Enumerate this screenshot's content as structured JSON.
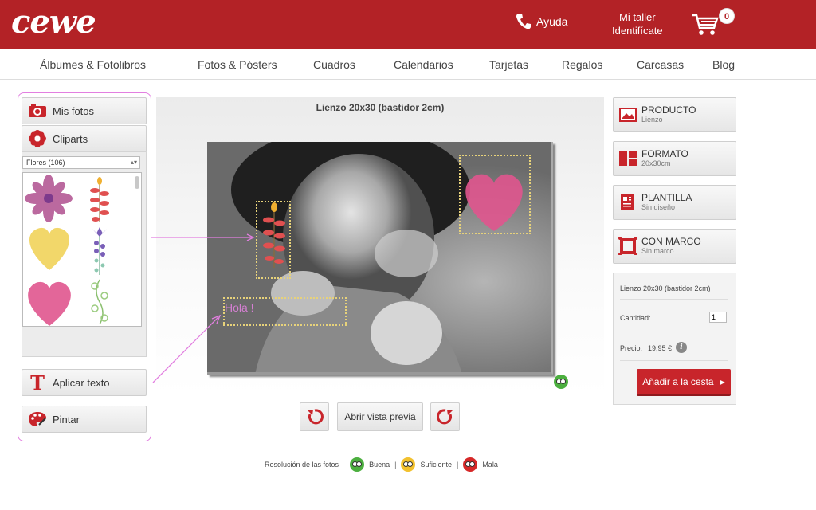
{
  "header": {
    "logo_text": "cewe",
    "help_label": "Ayuda",
    "account_line1": "Mi taller",
    "account_line2": "Identifícate",
    "cart_count": "0",
    "brand_color": "#b32226"
  },
  "nav": {
    "items": [
      "Álbumes & Fotolibros",
      "Fotos & Pósters",
      "Cuadros",
      "Calendarios",
      "Tarjetas",
      "Regalos",
      "Carcasas",
      "Blog"
    ]
  },
  "left_panel": {
    "my_photos_label": "Mis fotos",
    "cliparts_label": "Cliparts",
    "clipart_category": "Flores (106)",
    "apply_text_label": "Aplicar texto",
    "paint_label": "Pintar"
  },
  "canvas": {
    "title": "Lienzo 20x30 (bastidor 2cm)",
    "text_element": "Hola !",
    "preview_label": "Abrir vista previa"
  },
  "options": [
    {
      "title": "PRODUCTO",
      "subtitle": "Lienzo",
      "icon": "picture-icon"
    },
    {
      "title": "FORMATO",
      "subtitle": "20x30cm",
      "icon": "layout-icon"
    },
    {
      "title": "PLANTILLA",
      "subtitle": "Sin diseño",
      "icon": "template-icon"
    },
    {
      "title": "CON MARCO",
      "subtitle": "Sin marco",
      "icon": "frame-icon"
    }
  ],
  "summary": {
    "product_name": "Lienzo 20x30 (bastidor 2cm)",
    "quantity_label": "Cantidad:",
    "quantity_value": "1",
    "price_label": "Precio:",
    "price_value": "19,95 €",
    "add_to_cart_label": "Añadir a la cesta"
  },
  "resolution_legend": {
    "label": "Resolución de las fotos",
    "good": "Buena",
    "ok": "Suficiente",
    "bad": "Mala",
    "good_color": "#4caf3f",
    "ok_color": "#f2c12e",
    "bad_color": "#d62828"
  }
}
